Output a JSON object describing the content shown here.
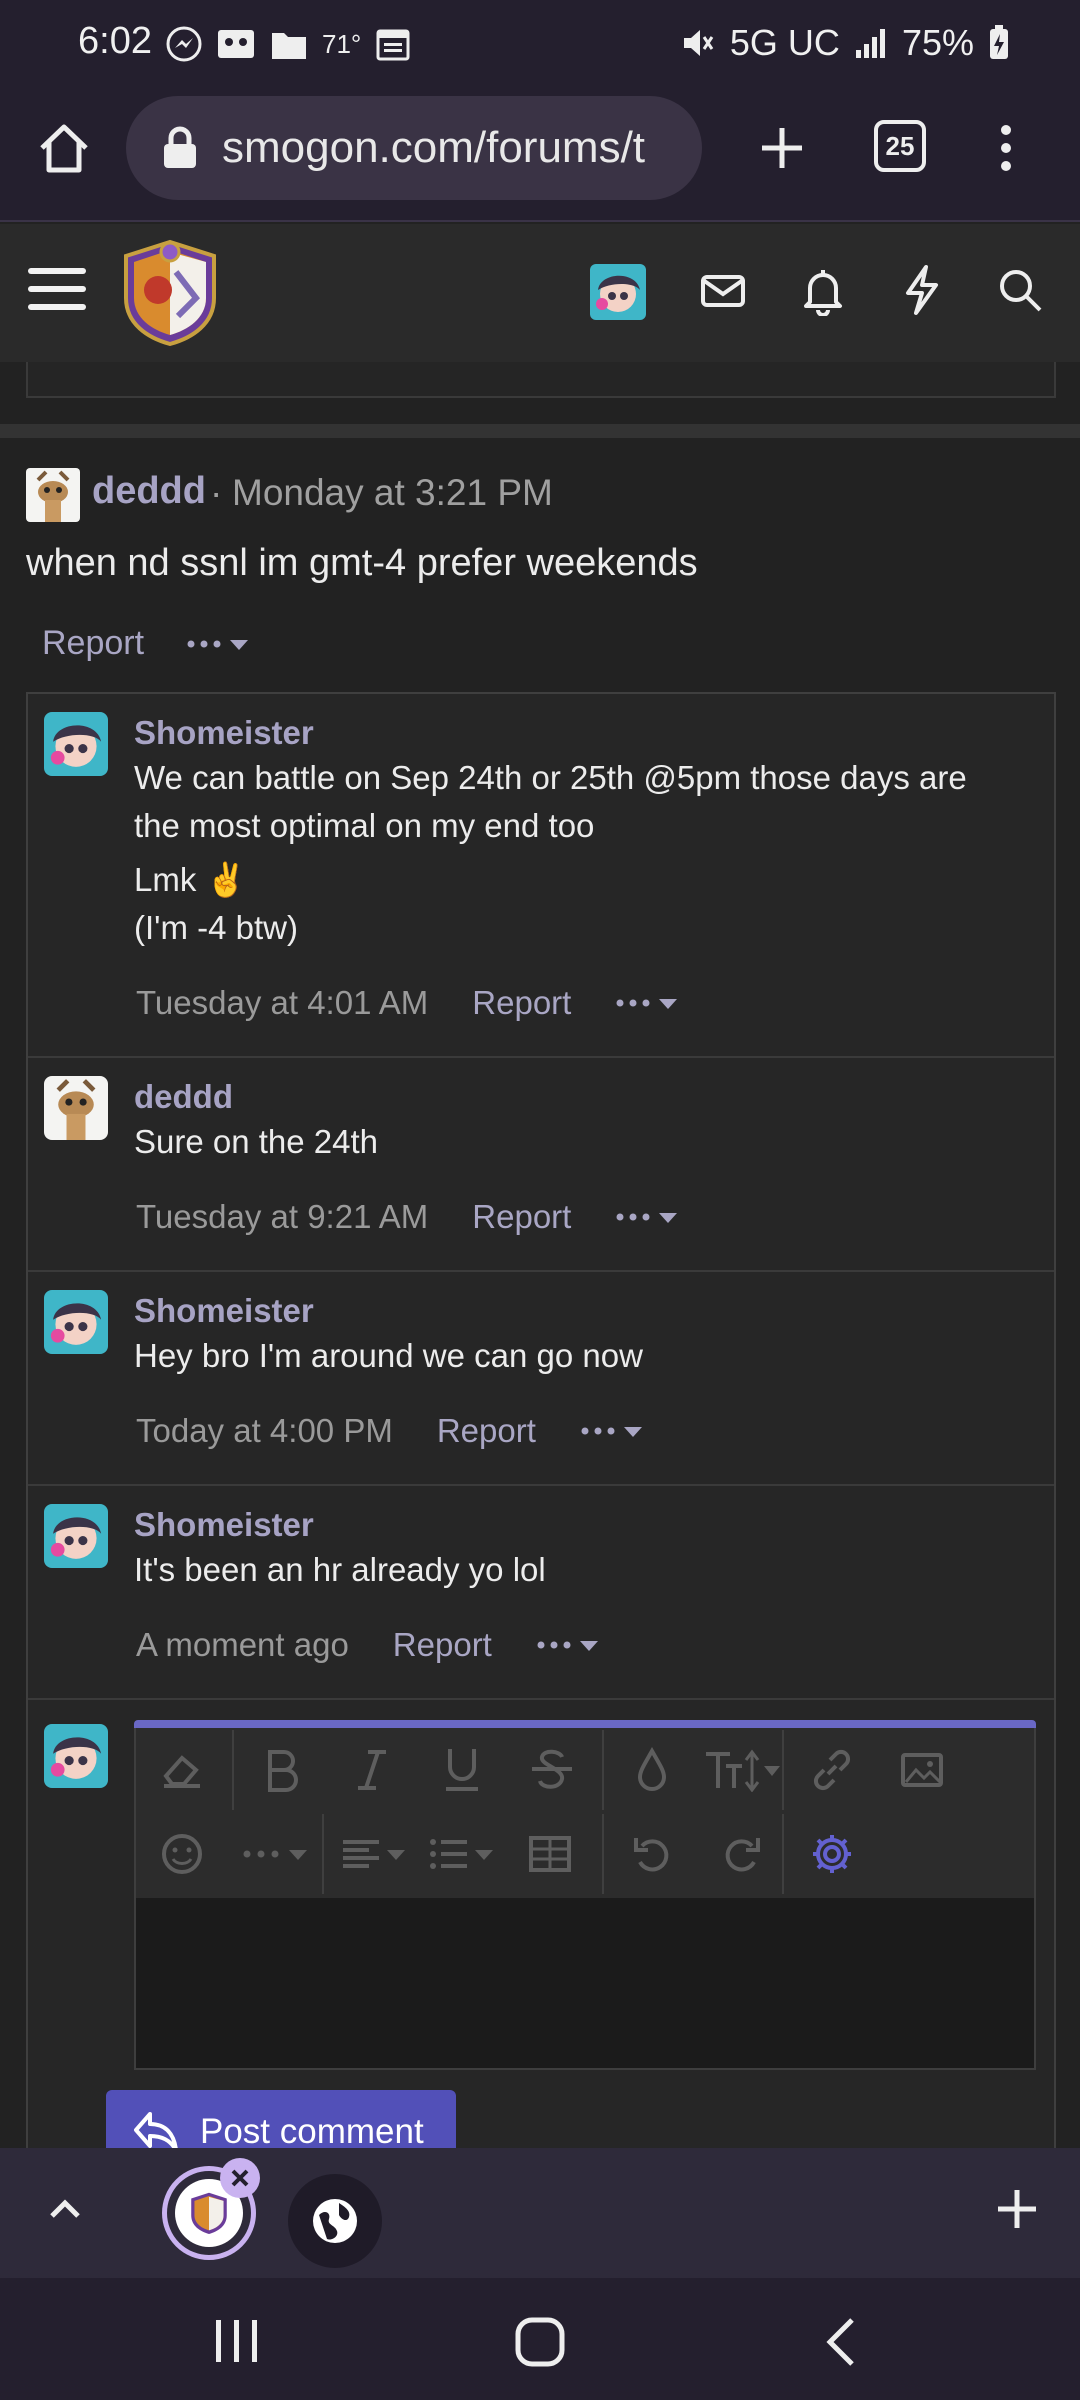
{
  "status_bar": {
    "time": "6:02",
    "temperature": "71°",
    "network": "5G UC",
    "battery": "75%"
  },
  "browser": {
    "url": "smogon.com/forums/t",
    "tab_count": "25"
  },
  "post": {
    "author": "deddd",
    "separator": "·",
    "date": "Monday at 3:21 PM",
    "body": "when nd ssnl im gmt-4 prefer weekends",
    "report_label": "Report"
  },
  "comments": [
    {
      "author": "Shomeister",
      "lines": [
        "We can battle on Sep 24th or 25th @5pm those days are",
        "the most optimal on my end too"
      ],
      "line2": "Lmk ✌️",
      "line3": "(I'm -4 btw)",
      "time": "Tuesday at 4:01 AM",
      "report": "Report"
    },
    {
      "author": "deddd",
      "text": "Sure on the 24th",
      "time": "Tuesday at 9:21 AM",
      "report": "Report"
    },
    {
      "author": "Shomeister",
      "text": "Hey bro I'm around we can go now",
      "time": "Today at 4:00 PM",
      "report": "Report"
    },
    {
      "author": "Shomeister",
      "text": "It's been an hr already yo lol",
      "time": "A moment ago",
      "report": "Report"
    }
  ],
  "editor": {
    "submit_label": "Post comment"
  },
  "colors": {
    "accent": "#5250b8",
    "username": "#a7a3c4"
  }
}
